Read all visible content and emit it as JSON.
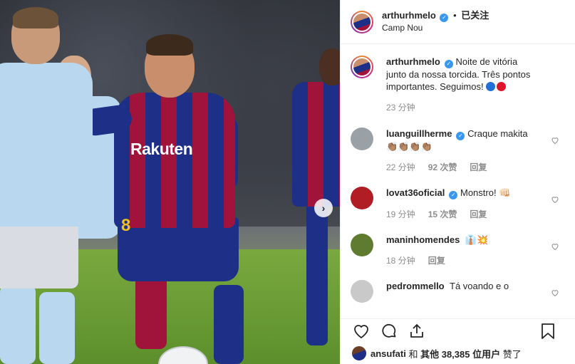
{
  "header": {
    "username": "arthurhmelo",
    "follow_label": "已关注",
    "dot": "•",
    "location": "Camp Nou"
  },
  "photo": {
    "sponsor_text": "Rakuten",
    "shirt_number": "8",
    "next_arrow": "›"
  },
  "caption": {
    "username": "arthurhmelo",
    "text": "Noite de vitória junto da nossa torcida. Três pontos importantes. Seguimos!",
    "time": "23 分钟",
    "emoji_colors": [
      "#1f6fd6",
      "#e0142a"
    ]
  },
  "comments": [
    {
      "username": "luanguillherme",
      "verified": true,
      "text": "Craque makita",
      "emoji_row": "👏🏽👏🏽👏🏽👏🏽",
      "time": "22 分钟",
      "likes": "92 次赞",
      "reply": "回复",
      "avatar_color": "#9aa1a6"
    },
    {
      "username": "lovat36oficial",
      "verified": true,
      "text": "Monstro!",
      "emoji_row": "👊🏻",
      "time": "19 分钟",
      "likes": "15 次赞",
      "reply": "回复",
      "avatar_color": "#b01d24"
    },
    {
      "username": "maninhomendes",
      "verified": false,
      "text": "",
      "emoji_row": "👔💥",
      "time": "18 分钟",
      "likes": "",
      "reply": "回复",
      "avatar_color": "#5e7b2f"
    },
    {
      "username": "pedrommello",
      "verified": false,
      "text": "Tá voando e o",
      "emoji_row": "",
      "time": "",
      "likes": "",
      "reply": "",
      "avatar_color": "#c9c9c9"
    }
  ],
  "likes_line": {
    "user": "ansufati",
    "and": "和",
    "others": "其他 38,385 位用户",
    "suffix": "赞了"
  },
  "icons": [
    "heart-icon",
    "comment-icon",
    "share-icon",
    "bookmark-icon",
    "next-arrow-icon",
    "verified-badge-icon"
  ]
}
